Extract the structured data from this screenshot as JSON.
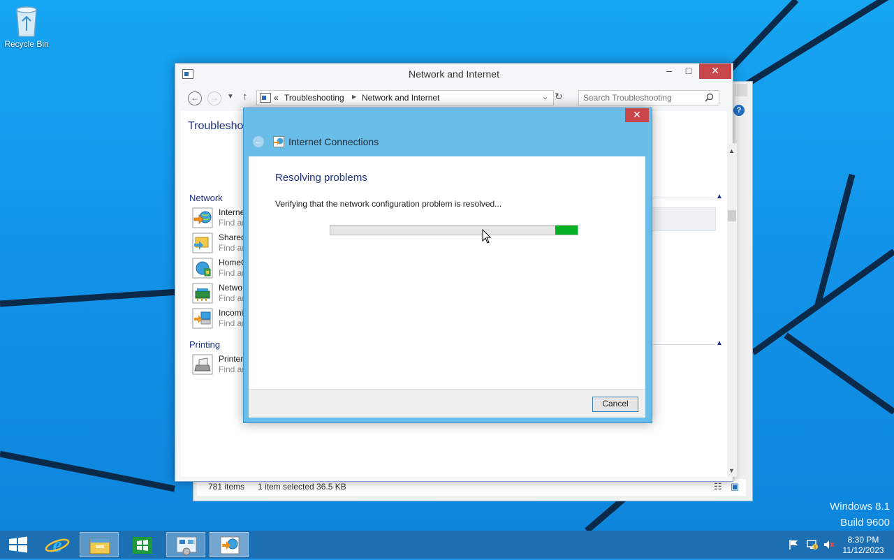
{
  "desktop": {
    "recycle_bin_label": "Recycle Bin",
    "watermark_line1": "Windows 8.1",
    "watermark_line2": "Build 9600"
  },
  "window": {
    "title": "Network and Internet",
    "address": {
      "chevrons": "«",
      "crumb1": "Troubleshooting",
      "crumb2": "Network and Internet"
    },
    "search_placeholder": "Search Troubleshooting",
    "page_title": "Troubleshoo",
    "sections": [
      {
        "label": "Network",
        "items": [
          {
            "title": "Interne",
            "sub": "Find an",
            "icon": "internet-connections-icon"
          },
          {
            "title": "Shared",
            "sub": "Find an",
            "icon": "shared-folders-icon"
          },
          {
            "title": "HomeG",
            "sub": "Find an",
            "icon": "homegroup-icon"
          },
          {
            "title": "Netwo",
            "sub": "Find an",
            "icon": "network-adapter-icon"
          },
          {
            "title": "Incomi",
            "sub": "Find an",
            "icon": "incoming-connections-icon"
          }
        ]
      },
      {
        "label": "Printing",
        "items": [
          {
            "title": "Printer",
            "sub": "Find an",
            "icon": "printer-icon"
          }
        ]
      }
    ]
  },
  "back_window": {
    "status_items": "781 items",
    "status_selected": "1 item selected  36.5 KB"
  },
  "dialog": {
    "title": "Internet Connections",
    "heading": "Resolving problems",
    "message": "Verifying that the network configuration problem is resolved...",
    "progress_position": 0.91,
    "progress_width": 0.09,
    "cancel_label": "Cancel"
  },
  "taskbar": {
    "time": "8:30 PM",
    "date": "11/12/2023"
  },
  "colors": {
    "accent_blue": "#1e3287",
    "progress_green": "#06b025",
    "close_red": "#c7474b",
    "taskbar": "#1d6fb4"
  }
}
